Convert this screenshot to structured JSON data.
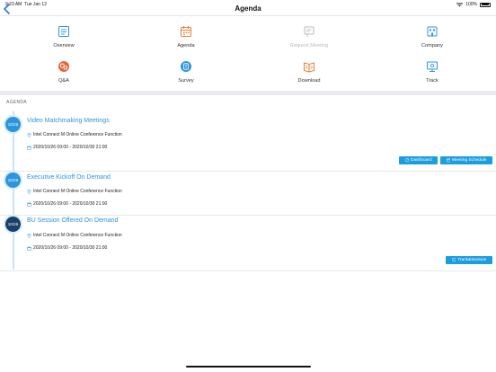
{
  "status": {
    "time": "9:23 AM",
    "date": "Tue Jan 12",
    "battery": "100%"
  },
  "nav": {
    "title": "Agenda"
  },
  "menu": [
    {
      "label": "Overview",
      "icon": "overview-icon",
      "color": "#2b95dd"
    },
    {
      "label": "Agenda",
      "icon": "calendar-icon",
      "color": "#e8803a"
    },
    {
      "label": "Request Meeting",
      "icon": "request-meeting-icon",
      "color": "#bbbbbb"
    },
    {
      "label": "Company",
      "icon": "company-icon",
      "color": "#2b95dd"
    },
    {
      "label": "Q&A",
      "icon": "qa-icon",
      "color": "#e8663a"
    },
    {
      "label": "Survey",
      "icon": "survey-icon",
      "color": "#2b95dd"
    },
    {
      "label": "Download",
      "icon": "download-icon",
      "color": "#e8803a"
    },
    {
      "label": "Track",
      "icon": "track-icon",
      "color": "#2b95dd"
    }
  ],
  "section": {
    "label": "AGENDA"
  },
  "agenda": [
    {
      "date": "10/26",
      "title": "Video Matchmaking Meetings",
      "location": "Intel Connect M Online Conference Function",
      "time": "2020/10/26 09:00 - 2020/10/30 21:00",
      "buttons": [
        "Dashboard",
        "Meeting Schedule"
      ]
    },
    {
      "date": "10/26",
      "title": "Executive Kickoff On Demand",
      "location": "Intel Connect M Online Conference Function",
      "time": "2020/10/26 09:00 - 2020/10/30 21:00",
      "buttons": []
    },
    {
      "date": "10/26",
      "title": "BU Session Offered On Demand",
      "location": "Intel Connect M Online Conference Function",
      "time": "2020/10/26 09:00 - 2020/10/30 21:00",
      "buttons": [
        "Track&Session"
      ]
    }
  ],
  "colors": {
    "accent": "#2b95dd",
    "button": "#1a9ee0",
    "badge_dark": "#1b3f6b"
  }
}
